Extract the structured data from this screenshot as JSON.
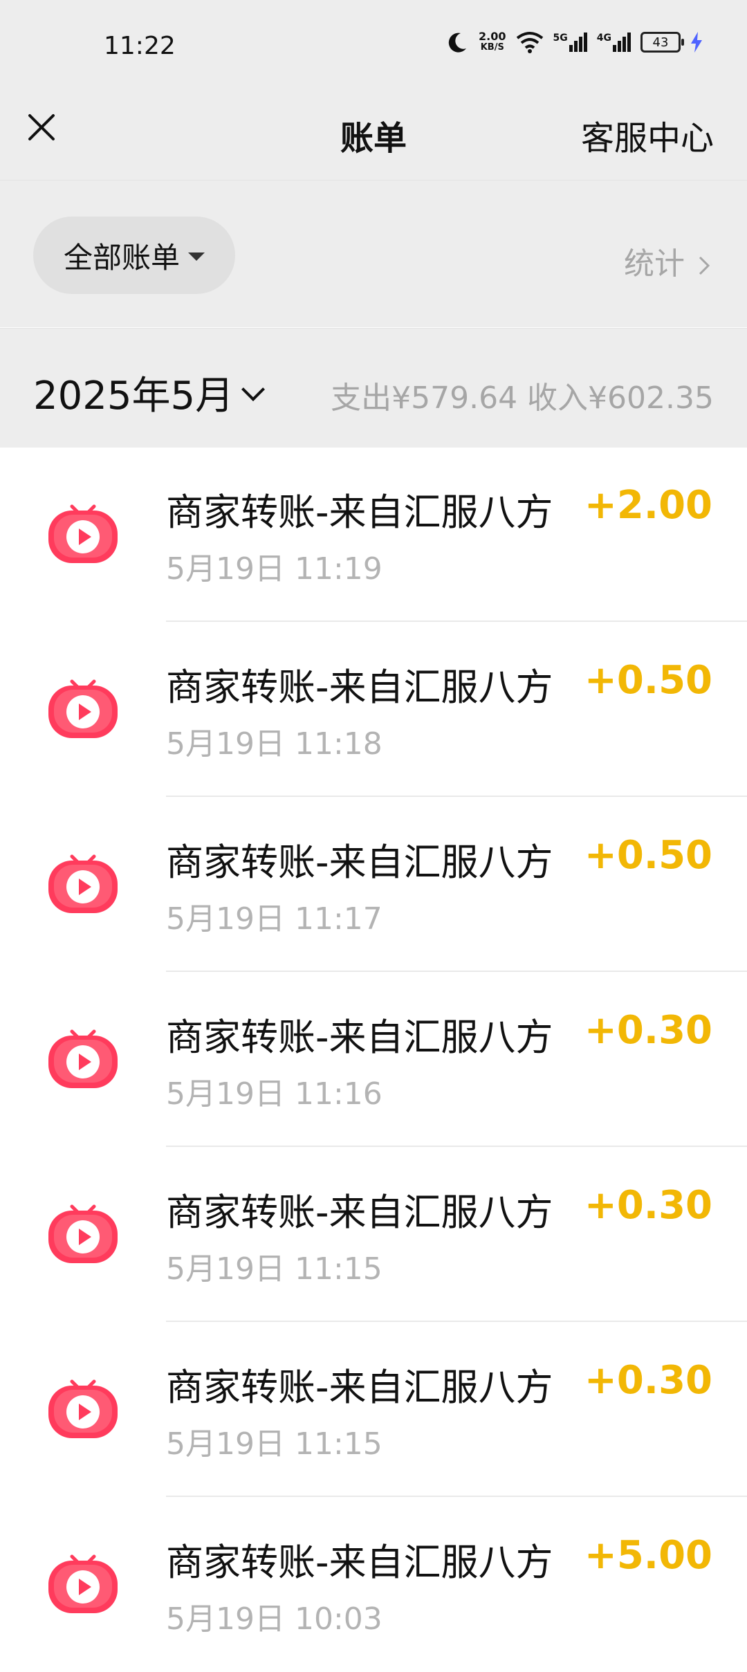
{
  "status_bar": {
    "time": "11:22",
    "net_speed_value": "2.00",
    "net_speed_unit": "KB/S",
    "signal_1": "5G",
    "signal_2": "4G",
    "battery": "43",
    "icons": [
      "moon-icon",
      "wifi-icon",
      "signal-icon",
      "signal-icon",
      "battery-icon",
      "charging-icon"
    ]
  },
  "nav": {
    "title": "账单",
    "right_label": "客服中心"
  },
  "filter": {
    "all_bills_label": "全部账单",
    "stats_label": "统计"
  },
  "month": {
    "label": "2025年5月",
    "summary": "支出¥579.64  收入¥602.35"
  },
  "colors": {
    "accent_amount": "#f2b705",
    "icon_red": "#fe2c55",
    "background_gray": "#ededed"
  },
  "transactions": [
    {
      "title": "商家转账-来自汇服八方",
      "time": "5月19日 11:19",
      "amount": "+2.00"
    },
    {
      "title": "商家转账-来自汇服八方",
      "time": "5月19日 11:18",
      "amount": "+0.50"
    },
    {
      "title": "商家转账-来自汇服八方",
      "time": "5月19日 11:17",
      "amount": "+0.50"
    },
    {
      "title": "商家转账-来自汇服八方",
      "time": "5月19日 11:16",
      "amount": "+0.30"
    },
    {
      "title": "商家转账-来自汇服八方",
      "time": "5月19日 11:15",
      "amount": "+0.30"
    },
    {
      "title": "商家转账-来自汇服八方",
      "time": "5月19日 11:15",
      "amount": "+0.30"
    },
    {
      "title": "商家转账-来自汇服八方",
      "time": "5月19日 10:03",
      "amount": "+5.00"
    }
  ]
}
